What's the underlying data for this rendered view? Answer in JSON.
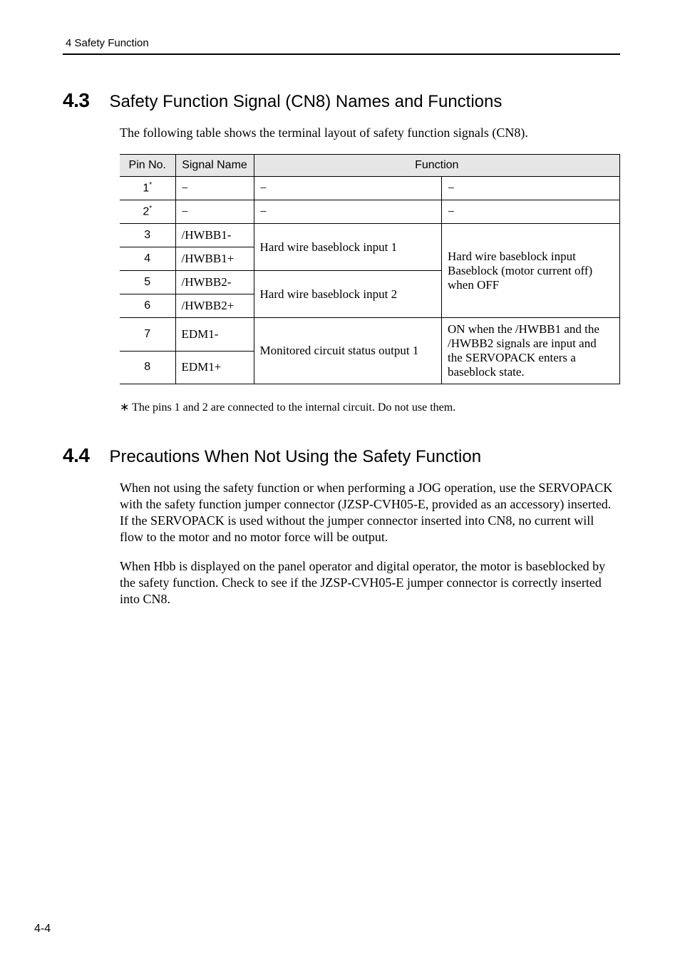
{
  "running_header": "4  Safety Function",
  "page_number": "4-4",
  "section_4_3": {
    "number": "4.3",
    "title": "Safety Function Signal (CN8) Names and Functions",
    "intro": "The following table shows the terminal layout of safety function signals (CN8).",
    "table": {
      "headers": {
        "pin": "Pin No.",
        "signal": "Signal Name",
        "function": "Function"
      },
      "rows": {
        "r1": {
          "pin": "1",
          "star": "*",
          "signal": "−",
          "f1": "−",
          "f2": "−"
        },
        "r2": {
          "pin": "2",
          "star": "*",
          "signal": "−",
          "f1": "−",
          "f2": "−"
        },
        "r3": {
          "pin": "3",
          "signal": "/HWBB1-"
        },
        "r4": {
          "pin": "4",
          "signal": "/HWBB1+"
        },
        "r5": {
          "pin": "5",
          "signal": "/HWBB2-"
        },
        "r6": {
          "pin": "6",
          "signal": "/HWBB2+"
        },
        "r7": {
          "pin": "7",
          "signal": "EDM1-"
        },
        "r8": {
          "pin": "8",
          "signal": "EDM1+"
        }
      },
      "merged": {
        "hwbb1": "Hard wire baseblock input 1",
        "hwbb2": "Hard wire baseblock input 2",
        "hwbb_desc": "Hard wire baseblock input Baseblock (motor current off) when OFF",
        "edm": "Monitored circuit status output 1",
        "edm_desc": "ON when the /HWBB1 and the /HWBB2 signals are input and the SERVOPACK enters a baseblock state."
      }
    },
    "footnote": "∗  The pins 1 and 2 are connected to the internal circuit. Do not use them."
  },
  "section_4_4": {
    "number": "4.4",
    "title": "Precautions When Not Using the Safety Function",
    "para1": "When not using the safety function or when performing a JOG operation, use the SERVOPACK with the safety function jumper connector (JZSP-CVH05-E, provided as an accessory) inserted. If the SERVOPACK is used without the jumper connector inserted into CN8, no current will flow to the motor and no motor force will be output.",
    "para2": "When Hbb is displayed on the panel operator and digital operator, the motor is baseblocked by the safety function. Check to see if the JZSP-CVH05-E jumper connector is correctly inserted into CN8."
  }
}
